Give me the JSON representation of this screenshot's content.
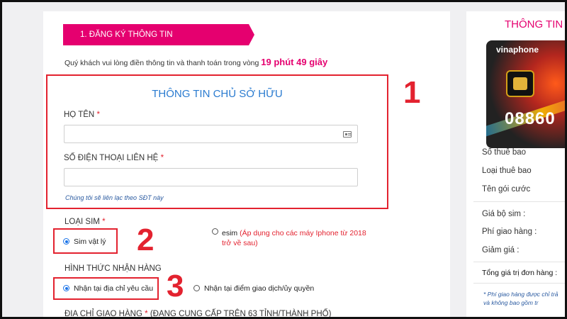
{
  "step": {
    "label": "1. ĐĂNG KÝ THÔNG TIN"
  },
  "notice": {
    "text": "Quý khách vui lòng điền thông tin và thanh toán trong vòng",
    "countdown": "19 phút 49 giây"
  },
  "owner": {
    "title": "THÔNG TIN CHỦ SỞ HỮU",
    "name_label": "HỌ TÊN",
    "name_value": "",
    "phone_label": "SỐ ĐIỆN THOẠI LIÊN HỆ",
    "phone_value": "",
    "phone_hint": "Chúng tôi sẽ liên lạc theo SĐT này",
    "required_mark": "*"
  },
  "sim_type": {
    "label": "LOẠI SIM",
    "options": [
      {
        "label": "Sim vật lý",
        "selected": true
      },
      {
        "label": "esim",
        "note_line1": "(Áp dụng cho các máy Iphone từ 2018",
        "note_line2": "trở về sau)",
        "selected": false
      }
    ]
  },
  "delivery": {
    "label": "HÌNH THỨC NHẬN HÀNG",
    "options": [
      {
        "label": "Nhận tại địa chỉ yêu cầu",
        "selected": true
      },
      {
        "label": "Nhận tại điểm giao dịch/ủy quyền",
        "selected": false
      }
    ]
  },
  "address": {
    "label": "ĐỊA CHỈ GIAO HÀNG",
    "note": "(ĐANG CUNG CẤP TRÊN 63 TỈNH/THÀNH PHỐ)"
  },
  "annotations": {
    "one": "1",
    "two": "2",
    "three": "3",
    "color": "#e3222f"
  },
  "summary": {
    "title": "THÔNG TIN ĐƠ",
    "sim_brand": "vinaphone",
    "sim_number": "08860",
    "rows": [
      "Số thuê bao",
      "Loại thuê bao",
      "Tên gói cước"
    ],
    "price_rows": [
      "Giá bộ sim :",
      "Phí giao hàng :",
      "Giảm giá :"
    ],
    "total_label": "Tổng giá trị đơn hàng :",
    "note_line1": "* Phí giao hàng được chỉ trả",
    "note_line2": "và không bao gồm tr"
  },
  "colors": {
    "brand": "#e5006f",
    "accent_blue": "#2a7bd0",
    "highlight_red": "#e3222f"
  }
}
